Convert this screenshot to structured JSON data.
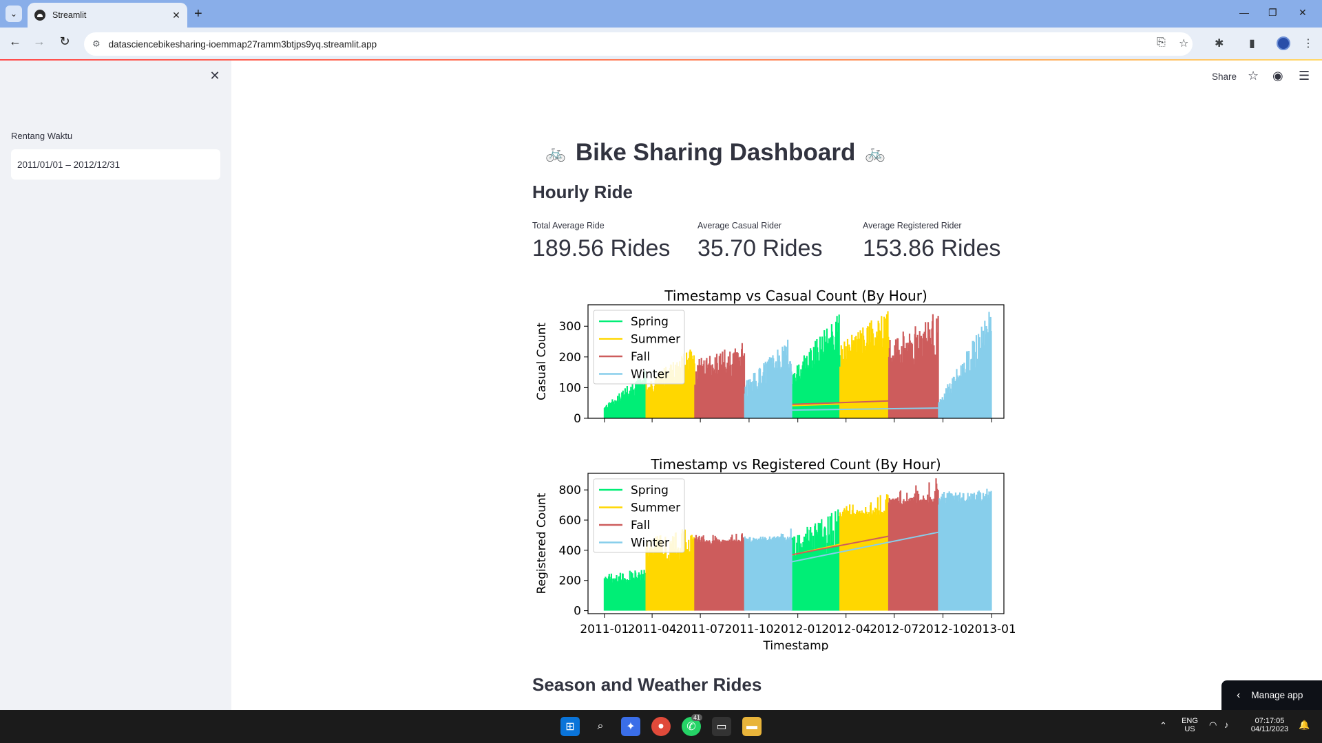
{
  "browser": {
    "tab_title": "Streamlit",
    "url": "datasciencebikesharing-ioemmap27ramm3btjps9yq.streamlit.app"
  },
  "sidebar": {
    "date_label": "Rentang Waktu",
    "date_value": "2011/01/01 – 2012/12/31"
  },
  "header": {
    "share_label": "Share"
  },
  "main": {
    "title": "Bike Sharing Dashboard",
    "title_emoji": "🚲",
    "section_hourly": "Hourly Ride",
    "metrics": [
      {
        "label": "Total Average Ride",
        "value": "189.56 Rides"
      },
      {
        "label": "Average Casual Rider",
        "value": "35.70 Rides"
      },
      {
        "label": "Average Registered Rider",
        "value": "153.86 Rides"
      }
    ],
    "section_season": "Season and Weather Rides"
  },
  "chart_data": [
    {
      "type": "line",
      "title": "Timestamp vs Casual Count (By Hour)",
      "xlabel": "",
      "ylabel": "Casual Count",
      "ylim": [
        0,
        370
      ],
      "yticks": [
        0,
        100,
        200,
        300
      ],
      "xlim": [
        "2010-12-01",
        "2013-01-24"
      ],
      "legend": "upper-left",
      "series": [
        {
          "name": "Spring",
          "color": "#00ee76",
          "segments": [
            [
              "2011-01-01",
              "2011-03-20",
              [
                5,
                48
              ],
              [
                40,
                160
              ]
            ],
            [
              "2011-12-21",
              "2012-03-20",
              [
                5,
                50
              ],
              [
                150,
                370
              ]
            ]
          ]
        },
        {
          "name": "Summer",
          "color": "#ffd700",
          "segments": [
            [
              "2011-03-21",
              "2011-06-20",
              [
                10,
                80
              ],
              [
                120,
                240
              ]
            ],
            [
              "2012-03-21",
              "2012-06-20",
              [
                20,
                120
              ],
              [
                250,
                360
              ]
            ]
          ]
        },
        {
          "name": "Fall",
          "color": "#cd5c5c",
          "segments": [
            [
              "2011-06-21",
              "2011-09-22",
              [
                20,
                100
              ],
              [
                190,
                250
              ]
            ],
            [
              "2012-06-21",
              "2012-09-22",
              [
                30,
                140
              ],
              [
                260,
                350
              ]
            ]
          ]
        },
        {
          "name": "Winter",
          "color": "#87ceeb",
          "segments": [
            [
              "2011-09-23",
              "2011-12-20",
              [
                10,
                70
              ],
              [
                120,
                270
              ]
            ],
            [
              "2012-09-23",
              "2012-12-31",
              [
                10,
                90
              ],
              [
                60,
                360
              ]
            ]
          ]
        }
      ]
    },
    {
      "type": "line",
      "title": "Timestamp vs Registered Count (By Hour)",
      "xlabel": "Timestamp",
      "ylabel": "Registered Count",
      "ylim": [
        -20,
        910
      ],
      "yticks": [
        0,
        200,
        400,
        600,
        800
      ],
      "xlim": [
        "2010-12-01",
        "2013-01-24"
      ],
      "xticks": [
        "2011-01",
        "2011-04",
        "2011-07",
        "2011-10",
        "2012-01",
        "2012-04",
        "2012-07",
        "2012-10",
        "2013-01"
      ],
      "legend": "upper-left",
      "series": [
        {
          "name": "Spring",
          "color": "#00ee76",
          "segments": [
            [
              "2011-01-01",
              "2011-03-20",
              [
                180,
                240
              ],
              [
                240,
                280
              ]
            ],
            [
              "2011-12-21",
              "2012-03-20",
              [
                330,
                400
              ],
              [
                500,
                700
              ]
            ]
          ]
        },
        {
          "name": "Summer",
          "color": "#ffd700",
          "segments": [
            [
              "2011-03-21",
              "2011-06-20",
              [
                280,
                400
              ],
              [
                480,
                560
              ]
            ],
            [
              "2012-03-21",
              "2012-06-20",
              [
                620,
                700
              ],
              [
                700,
                780
              ]
            ]
          ]
        },
        {
          "name": "Fall",
          "color": "#cd5c5c",
          "segments": [
            [
              "2011-06-21",
              "2011-09-22",
              [
                430,
                500
              ],
              [
                500,
                530
              ]
            ],
            [
              "2012-06-21",
              "2012-09-22",
              [
                700,
                780
              ],
              [
                780,
                890
              ]
            ]
          ]
        },
        {
          "name": "Winter",
          "color": "#87ceeb",
          "segments": [
            [
              "2011-09-23",
              "2011-12-20",
              [
                450,
                520
              ],
              [
                400,
                550
              ]
            ],
            [
              "2012-09-23",
              "2012-12-31",
              [
                700,
                860
              ],
              [
                240,
                880
              ]
            ]
          ]
        }
      ]
    }
  ],
  "manage_app_label": "Manage app",
  "taskbar": {
    "lang_top": "ENG",
    "lang_bottom": "US",
    "time": "07:17:05",
    "date": "04/11/2023",
    "whatsapp_badge": "41"
  }
}
